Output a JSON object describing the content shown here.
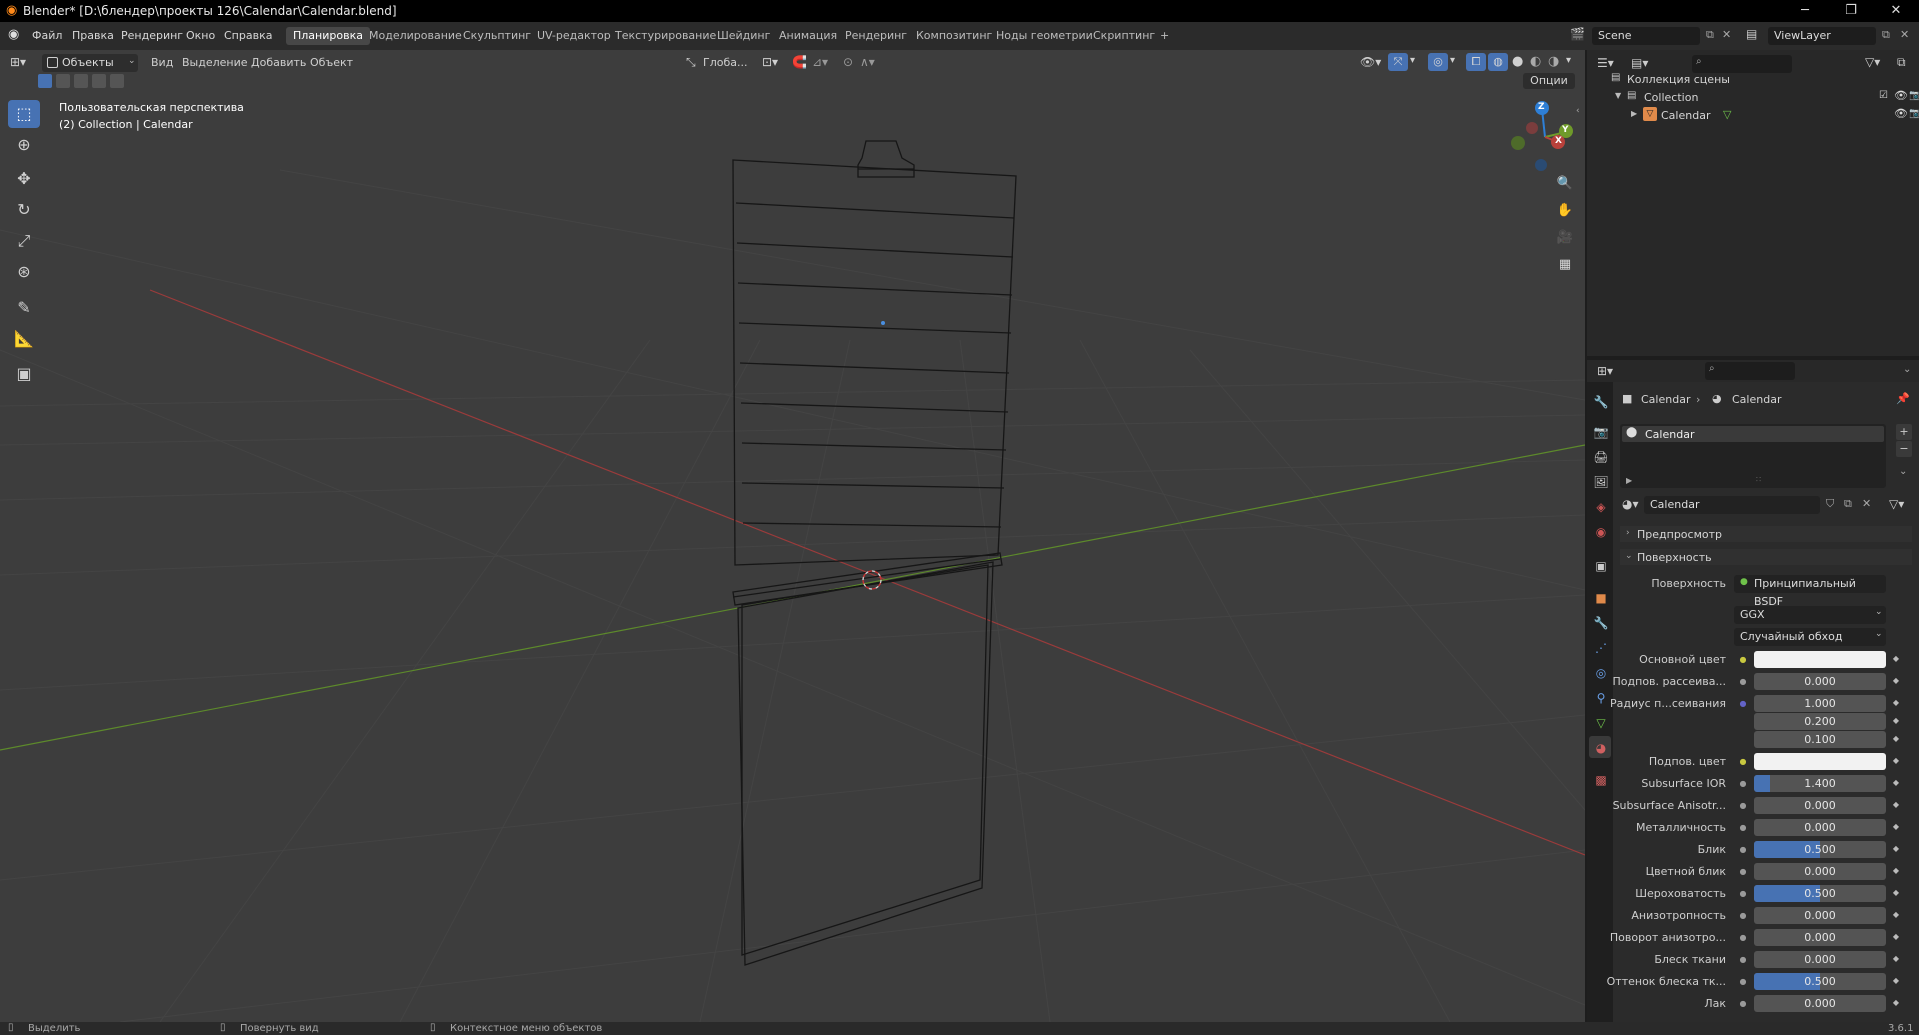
{
  "window": {
    "title": "Blender* [D:\\блендер\\проекты 126\\Calendar\\Calendar.blend]",
    "minimize": "─",
    "maximize": "❐",
    "close": "✕"
  },
  "menu": [
    "Файл",
    "Правка",
    "Рендеринг",
    "Окно",
    "Справка"
  ],
  "workspaces": [
    "Планировка",
    "Моделирование",
    "Скульптинг",
    "UV-редактор",
    "Текстурирование",
    "Шейдинг",
    "Анимация",
    "Рендеринг",
    "Композитинг",
    "Ноды геометрии",
    "Скриптинг",
    "+"
  ],
  "active_workspace": 0,
  "scene": {
    "name": "Scene"
  },
  "view_layer": {
    "name": "ViewLayer"
  },
  "viewport": {
    "mode": "Объекты",
    "menus": [
      "Вид",
      "Выделение",
      "Добавить",
      "Объект"
    ],
    "orientation": "Глоба...",
    "options": "Опции",
    "info_line1": "Пользовательская перспектива",
    "info_line2": "(2) Collection | Calendar",
    "gizmo": {
      "z": "Z",
      "y": "Y",
      "x": "X"
    }
  },
  "outliner": {
    "search_placeholder": "",
    "items": [
      {
        "label": "Коллекция сцены"
      },
      {
        "label": "Collection"
      },
      {
        "label": "Calendar"
      }
    ]
  },
  "properties": {
    "breadcrumb": [
      "Calendar",
      "Calendar"
    ],
    "material_slot": "Calendar",
    "material_name": "Calendar",
    "sections": {
      "preview": "Предпросмотр",
      "surface": "Поверхность"
    },
    "surface_label": "Поверхность",
    "surface_value": "Принципиальный BSDF",
    "distribution": "GGX",
    "subsurface_method": "Случайный обход",
    "rows": [
      {
        "label": "Основной цвет",
        "type": "color",
        "value": "",
        "color": "#f2f2f2",
        "dot": "yellow"
      },
      {
        "label": "Подпов. рассеива...",
        "type": "number",
        "value": "0.000",
        "fill": 0
      },
      {
        "label": "Радиус п...сеивания",
        "type": "number",
        "value": "1.000",
        "fill": 0,
        "dot": "purple"
      },
      {
        "label": "",
        "type": "number",
        "value": "0.200",
        "fill": 0,
        "nodot": true
      },
      {
        "label": "",
        "type": "number",
        "value": "0.100",
        "fill": 0,
        "nodot": true
      },
      {
        "label": "Подпов. цвет",
        "type": "color",
        "value": "",
        "color": "#f2f2f2",
        "dot": "yellow"
      },
      {
        "label": "Subsurface IOR",
        "type": "number",
        "value": "1.400",
        "fill": 0.12
      },
      {
        "label": "Subsurface Anisotr...",
        "type": "number",
        "value": "0.000",
        "fill": 0
      },
      {
        "label": "Металличность",
        "type": "number",
        "value": "0.000",
        "fill": 0
      },
      {
        "label": "Блик",
        "type": "number",
        "value": "0.500",
        "fill": 0.5
      },
      {
        "label": "Цветной блик",
        "type": "number",
        "value": "0.000",
        "fill": 0
      },
      {
        "label": "Шероховатость",
        "type": "number",
        "value": "0.500",
        "fill": 0.5
      },
      {
        "label": "Анизотропность",
        "type": "number",
        "value": "0.000",
        "fill": 0
      },
      {
        "label": "Поворот анизотро...",
        "type": "number",
        "value": "0.000",
        "fill": 0
      },
      {
        "label": "Блеск ткани",
        "type": "number",
        "value": "0.000",
        "fill": 0
      },
      {
        "label": "Оттенок блеска тк...",
        "type": "number",
        "value": "0.500",
        "fill": 0.5
      },
      {
        "label": "Лак",
        "type": "number",
        "value": "0.000",
        "fill": 0
      }
    ]
  },
  "status": {
    "select": "Выделить",
    "rotate": "Повернуть вид",
    "context": "Контекстное меню объектов",
    "version": "3.6.1"
  },
  "colors": {
    "accent": "#4772b3",
    "x_axis": "#b8413b",
    "y_axis": "#6f9a2a",
    "z_axis": "#2e7fd6"
  }
}
